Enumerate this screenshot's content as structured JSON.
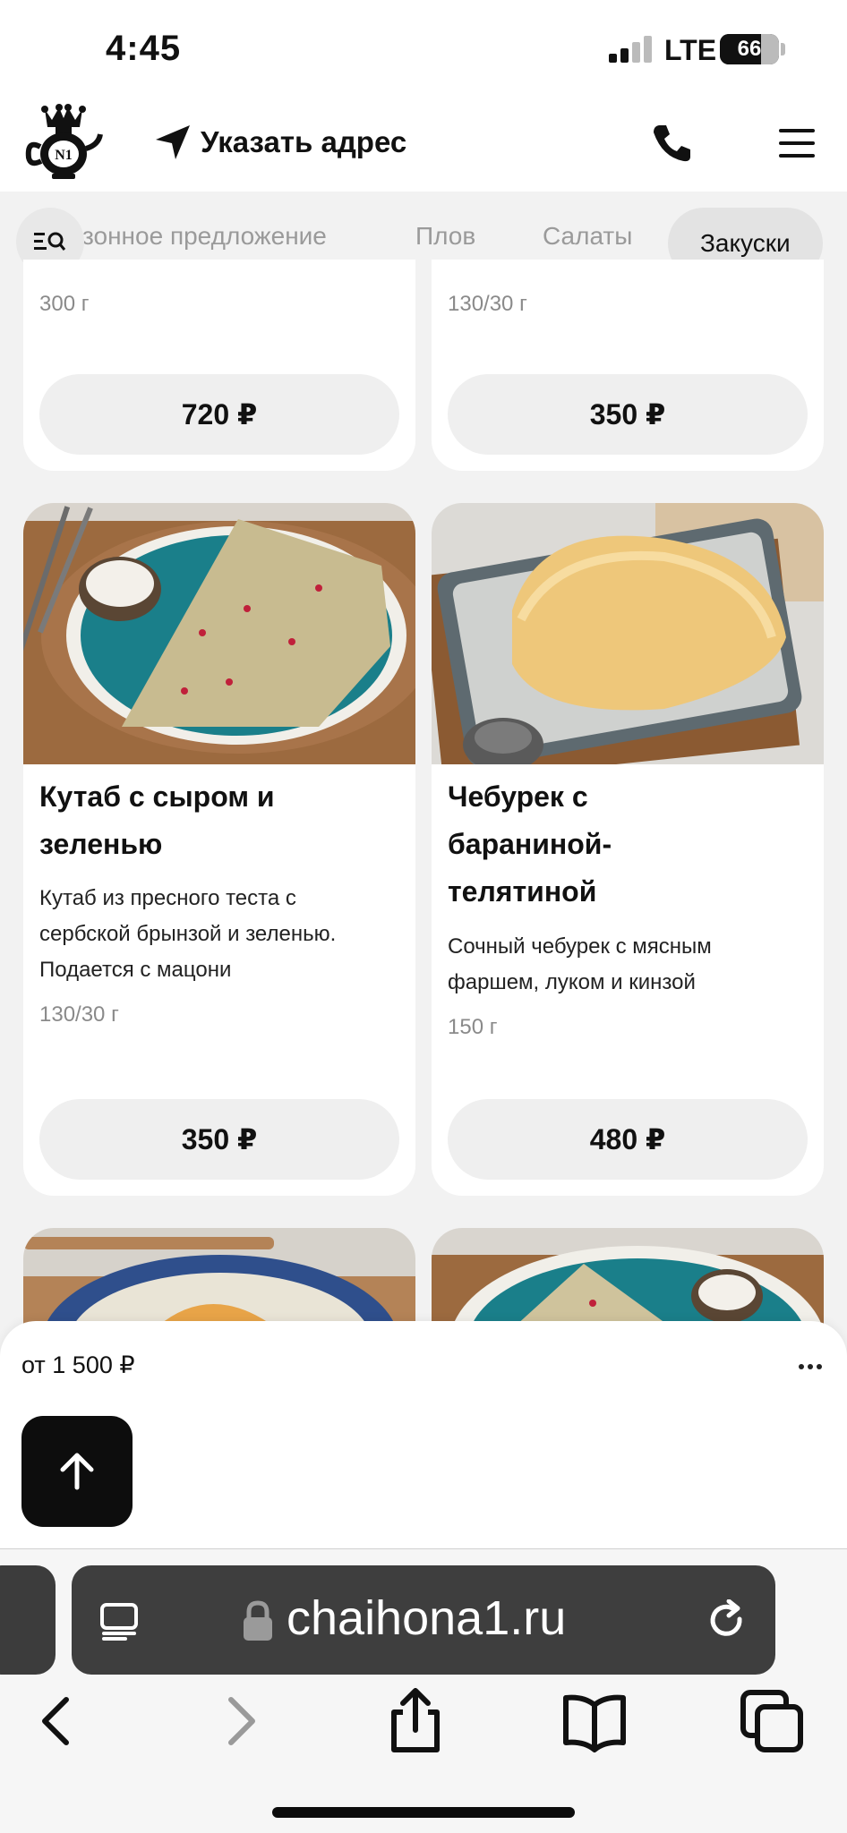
{
  "status_bar": {
    "time": "4:45",
    "network": "LTE",
    "battery": "66",
    "battery_level": 0.66
  },
  "header": {
    "logo_icon": "teapot-logo-icon",
    "address_label": "Указать адрес",
    "phone_icon": "phone-icon",
    "menu_icon": "hamburger-menu-icon"
  },
  "categories": {
    "filter_icon": "search-list-icon",
    "items": [
      "зонное предложение",
      "Плов",
      "Салаты",
      "Закуски"
    ],
    "active": "Закуски"
  },
  "products": [
    {
      "weight": "300 г",
      "price": "720 ₽"
    },
    {
      "weight": "130/30 г",
      "price": "350 ₽"
    },
    {
      "title_line1": "Кутаб с сыром и",
      "title_line2": "зеленью",
      "desc_line1": "Кутаб из пресного теста с",
      "desc_line2": "сербской брынзой и зеленью.",
      "desc_line3": "Подается с мацони",
      "weight": "130/30 г",
      "price": "350 ₽"
    },
    {
      "title_line1": "Чебурек с",
      "title_line2": "бараниной-",
      "title_line3": "телятиной",
      "desc_line1": "Сочный чебурек с мясным",
      "desc_line2": "фаршем, луком и кинзой",
      "weight": "150 г",
      "price": "480 ₽"
    }
  ],
  "bottom_sheet": {
    "min_order": "от 1 500 ₽",
    "more_icon": "more-dots-icon",
    "scroll_up_icon": "arrow-up-icon"
  },
  "browser": {
    "url": "chaihona1.ru",
    "reader_icon": "reader-icon",
    "lock_icon": "lock-icon",
    "reload_icon": "reload-icon",
    "nav_icons": [
      "back-icon",
      "forward-icon",
      "share-icon",
      "bookmarks-icon",
      "tabs-icon"
    ]
  }
}
